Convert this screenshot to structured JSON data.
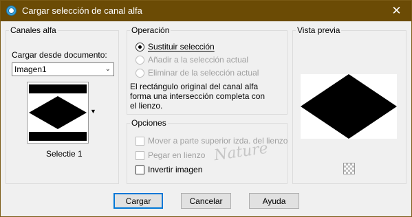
{
  "window": {
    "title": "Cargar selección de canal alfa",
    "close_glyph": "✕"
  },
  "alpha_channels": {
    "group_title": "Canales alfa",
    "load_from_label": "Cargar desde documento:",
    "document_value": "Imagen1",
    "channel_name": "Selectie 1"
  },
  "operation": {
    "group_title": "Operación",
    "options": [
      {
        "label": "Sustituir selección",
        "checked": true,
        "enabled": true
      },
      {
        "label": "Añadir a la selección actual",
        "checked": false,
        "enabled": false
      },
      {
        "label": "Eliminar de la selección actual",
        "checked": false,
        "enabled": false
      }
    ],
    "description": "El rectángulo original del canal alfa forma una intersección completa con el lienzo."
  },
  "options": {
    "group_title": "Opciones",
    "items": [
      {
        "label": "Mover a parte superior izda. del lienzo",
        "checked": false,
        "enabled": false
      },
      {
        "label": "Pegar en lienzo",
        "checked": false,
        "enabled": false
      },
      {
        "label": "Invertir imagen",
        "checked": false,
        "enabled": true
      }
    ]
  },
  "preview": {
    "group_title": "Vista previa",
    "background_icon": "checkerboard-icon"
  },
  "buttons": {
    "load": "Cargar",
    "cancel": "Cancelar",
    "help": "Ayuda"
  },
  "watermark": "Nature",
  "colors": {
    "titlebar": "#6b4b05",
    "default_button_border": "#0078d7"
  }
}
